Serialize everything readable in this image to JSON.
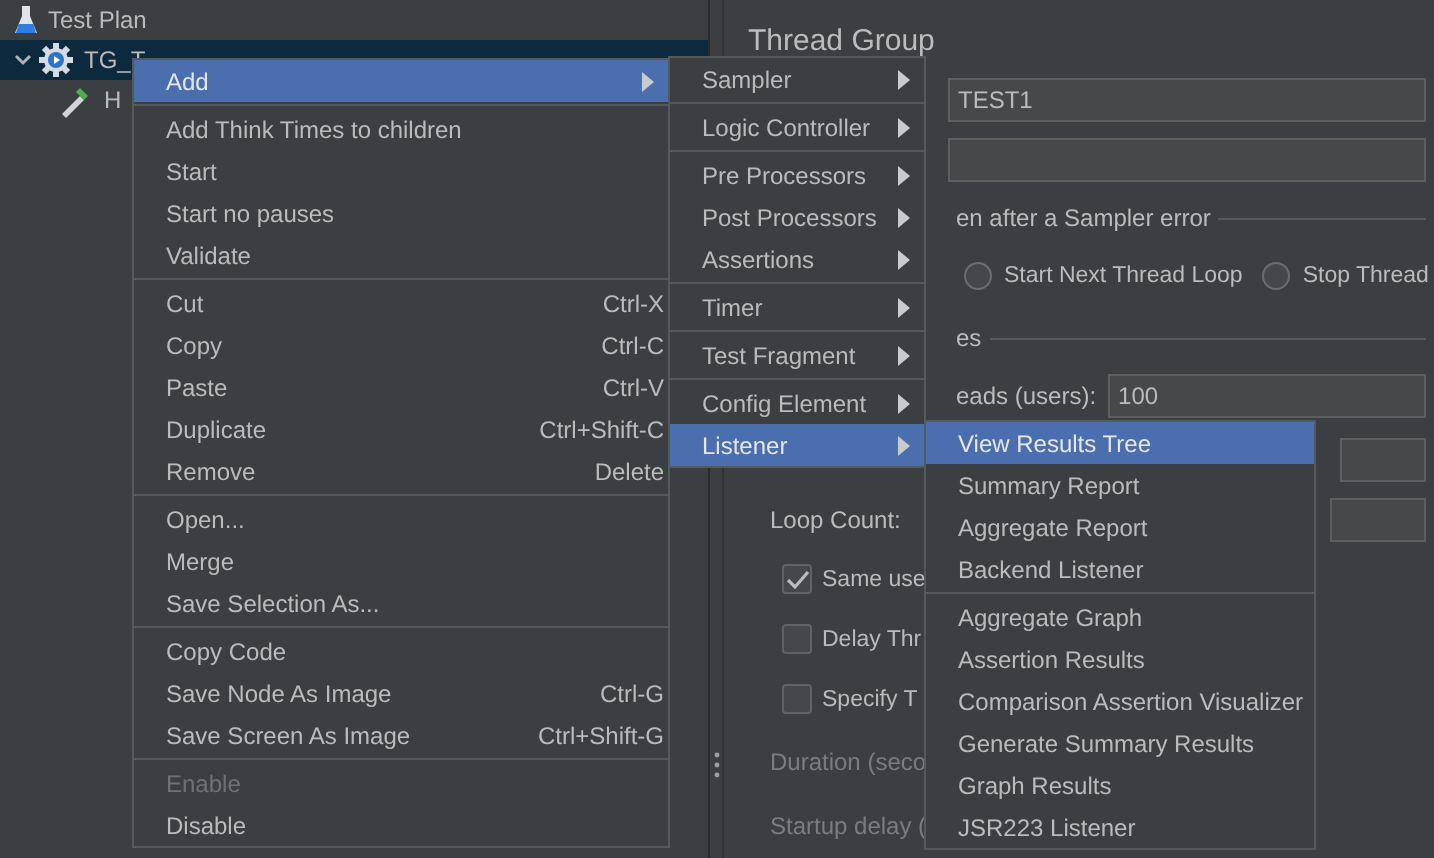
{
  "tree": {
    "items": [
      {
        "label": "Test Plan",
        "kind": "plan",
        "selected": false,
        "expanded": false,
        "children": [
          {
            "label": "TG_T",
            "kind": "group",
            "selected": true,
            "expanded": true,
            "children": [
              {
                "label": "H",
                "kind": "sampler",
                "selected": false,
                "expanded": false
              }
            ]
          }
        ]
      }
    ]
  },
  "panel": {
    "title": "Thread Group",
    "name_value": "TEST1",
    "error_action": {
      "legend": "en after a Sampler error",
      "options": [
        {
          "label": "Start Next Thread Loop",
          "selected": false
        },
        {
          "label": "Stop Thread",
          "selected": false
        }
      ]
    },
    "thread_properties": {
      "legend": "es",
      "threads_label": "eads (users):",
      "threads_value": "100",
      "loop_count_label": "Loop Count:",
      "options": [
        {
          "label": "Same use",
          "checked": true
        },
        {
          "label": "Delay Thr",
          "checked": false
        },
        {
          "label": "Specify T",
          "checked": false
        }
      ],
      "fields": [
        {
          "label": "Duration (seco",
          "disabled": true
        },
        {
          "label": "Startup delay (",
          "disabled": true
        }
      ]
    }
  },
  "context_menu": {
    "groups": [
      [
        {
          "label": "Add",
          "has_submenu": true,
          "selected": true,
          "disabled": false
        }
      ],
      [
        {
          "label": "Add Think Times to children",
          "has_submenu": false,
          "selected": false,
          "disabled": false
        },
        {
          "label": "Start",
          "has_submenu": false,
          "selected": false,
          "disabled": false
        },
        {
          "label": "Start no pauses",
          "has_submenu": false,
          "selected": false,
          "disabled": false
        },
        {
          "label": "Validate",
          "has_submenu": false,
          "selected": false,
          "disabled": false
        }
      ],
      [
        {
          "label": "Cut",
          "shortcut": "Ctrl-X",
          "has_submenu": false,
          "selected": false,
          "disabled": false
        },
        {
          "label": "Copy",
          "shortcut": "Ctrl-C",
          "has_submenu": false,
          "selected": false,
          "disabled": false
        },
        {
          "label": "Paste",
          "shortcut": "Ctrl-V",
          "has_submenu": false,
          "selected": false,
          "disabled": false
        },
        {
          "label": "Duplicate",
          "shortcut": "Ctrl+Shift-C",
          "has_submenu": false,
          "selected": false,
          "disabled": false
        },
        {
          "label": "Remove",
          "shortcut": "Delete",
          "has_submenu": false,
          "selected": false,
          "disabled": false
        }
      ],
      [
        {
          "label": "Open...",
          "has_submenu": false,
          "selected": false,
          "disabled": false
        },
        {
          "label": "Merge",
          "has_submenu": false,
          "selected": false,
          "disabled": false
        },
        {
          "label": "Save Selection As...",
          "has_submenu": false,
          "selected": false,
          "disabled": false
        }
      ],
      [
        {
          "label": "Copy Code",
          "has_submenu": false,
          "selected": false,
          "disabled": false
        },
        {
          "label": "Save Node As Image",
          "shortcut": "Ctrl-G",
          "has_submenu": false,
          "selected": false,
          "disabled": false
        },
        {
          "label": "Save Screen As Image",
          "shortcut": "Ctrl+Shift-G",
          "has_submenu": false,
          "selected": false,
          "disabled": false
        }
      ],
      [
        {
          "label": "Enable",
          "has_submenu": false,
          "selected": false,
          "disabled": true
        },
        {
          "label": "Disable",
          "has_submenu": false,
          "selected": false,
          "disabled": false
        }
      ]
    ]
  },
  "add_submenu": {
    "groups": [
      [
        {
          "label": "Sampler",
          "has_submenu": true,
          "selected": false
        }
      ],
      [
        {
          "label": "Logic Controller",
          "has_submenu": true,
          "selected": false
        }
      ],
      [
        {
          "label": "Pre Processors",
          "has_submenu": true,
          "selected": false
        },
        {
          "label": "Post Processors",
          "has_submenu": true,
          "selected": false
        },
        {
          "label": "Assertions",
          "has_submenu": true,
          "selected": false
        }
      ],
      [
        {
          "label": "Timer",
          "has_submenu": true,
          "selected": false
        }
      ],
      [
        {
          "label": "Test Fragment",
          "has_submenu": true,
          "selected": false
        }
      ],
      [
        {
          "label": "Config Element",
          "has_submenu": true,
          "selected": false
        },
        {
          "label": "Listener",
          "has_submenu": true,
          "selected": true
        }
      ]
    ]
  },
  "listener_submenu": {
    "groups": [
      [
        {
          "label": "View Results Tree",
          "has_submenu": false,
          "selected": true
        },
        {
          "label": "Summary Report",
          "has_submenu": false,
          "selected": false
        },
        {
          "label": "Aggregate Report",
          "has_submenu": false,
          "selected": false
        },
        {
          "label": "Backend Listener",
          "has_submenu": false,
          "selected": false
        }
      ],
      [
        {
          "label": "Aggregate Graph",
          "has_submenu": false,
          "selected": false
        },
        {
          "label": "Assertion Results",
          "has_submenu": false,
          "selected": false
        },
        {
          "label": "Comparison Assertion Visualizer",
          "has_submenu": false,
          "selected": false
        },
        {
          "label": "Generate Summary Results",
          "has_submenu": false,
          "selected": false
        },
        {
          "label": "Graph Results",
          "has_submenu": false,
          "selected": false
        },
        {
          "label": "JSR223 Listener",
          "has_submenu": false,
          "selected": false
        }
      ]
    ]
  }
}
